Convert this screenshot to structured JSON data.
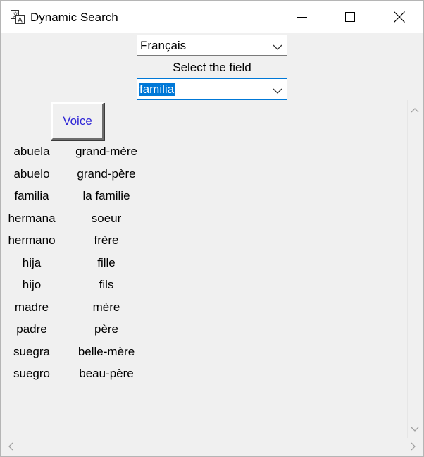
{
  "window": {
    "title": "Dynamic Search",
    "app_icon": "translate-icon",
    "controls": [
      "minimize-icon",
      "maximize-icon",
      "close-icon"
    ]
  },
  "language_select": {
    "value": "Français"
  },
  "field_label": "Select the field",
  "field_select": {
    "value": "familia"
  },
  "voice_button": {
    "label": "Voice",
    "color": "#2f26d6"
  },
  "words": [
    {
      "es": "abuela",
      "fr": "grand-mère"
    },
    {
      "es": "abuelo",
      "fr": "grand-père"
    },
    {
      "es": "familia",
      "fr": "la familie"
    },
    {
      "es": "hermana",
      "fr": "soeur"
    },
    {
      "es": "hermano",
      "fr": "frère"
    },
    {
      "es": "hija",
      "fr": "fille"
    },
    {
      "es": "hijo",
      "fr": "fils"
    },
    {
      "es": "madre",
      "fr": "mère"
    },
    {
      "es": "padre",
      "fr": "père"
    },
    {
      "es": "suegra",
      "fr": "belle-mère"
    },
    {
      "es": "suegro",
      "fr": "beau-père"
    }
  ],
  "colors": {
    "selection": "#0078d7",
    "focus_border": "#0078d7",
    "background": "#f0f0f0"
  }
}
